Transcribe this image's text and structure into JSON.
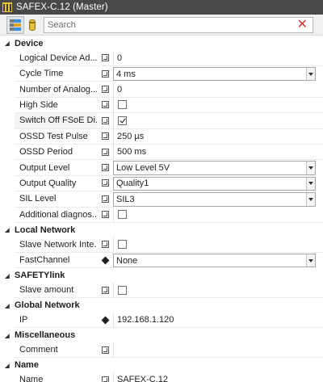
{
  "window": {
    "title": "SAFEX-C.12 (Master)"
  },
  "toolbar": {
    "search_placeholder": "Search"
  },
  "colors": {
    "titlebar": "#48484a",
    "clear_icon": "#d23a3a",
    "device_icon": "#e9c33a"
  },
  "categories": {
    "device": {
      "label": "Device",
      "rows": {
        "logical_device_address": {
          "label": "Logical Device Ad...",
          "value": "0"
        },
        "cycle_time": {
          "label": "Cycle Time",
          "value": "4 ms"
        },
        "number_of_analog": {
          "label": "Number of Analog...",
          "value": "0"
        },
        "high_side": {
          "label": "High Side",
          "checked": false
        },
        "switch_off_fsoe": {
          "label": "Switch Off FSoE Di...",
          "checked": true
        },
        "ossd_test_pulse": {
          "label": "OSSD Test Pulse",
          "value": "250 µs"
        },
        "ossd_period": {
          "label": "OSSD Period",
          "value": "500 ms"
        },
        "output_level": {
          "label": "Output Level",
          "value": "Low Level 5V"
        },
        "output_quality": {
          "label": "Output Quality",
          "value": "Quality1"
        },
        "sil_level": {
          "label": "SIL Level",
          "value": "SIL3"
        },
        "additional_diagnostics": {
          "label": "Additional diagnos...",
          "checked": false
        }
      }
    },
    "local_network": {
      "label": "Local Network",
      "rows": {
        "slave_network_interface": {
          "label": "Slave Network Inte...",
          "checked": false
        },
        "fast_channel": {
          "label": "FastChannel",
          "value": "None"
        }
      }
    },
    "safetylink": {
      "label": "SAFETYlink",
      "rows": {
        "slave_amount": {
          "label": "Slave amount",
          "checked": false
        }
      }
    },
    "global_network": {
      "label": "Global Network",
      "rows": {
        "ip": {
          "label": "IP",
          "value": "192.168.1.120"
        }
      }
    },
    "miscellaneous": {
      "label": "Miscellaneous",
      "rows": {
        "comment": {
          "label": "Comment",
          "value": ""
        }
      }
    },
    "name": {
      "label": "Name",
      "rows": {
        "name": {
          "label": "Name",
          "value": "SAFEX-C.12"
        }
      }
    }
  }
}
